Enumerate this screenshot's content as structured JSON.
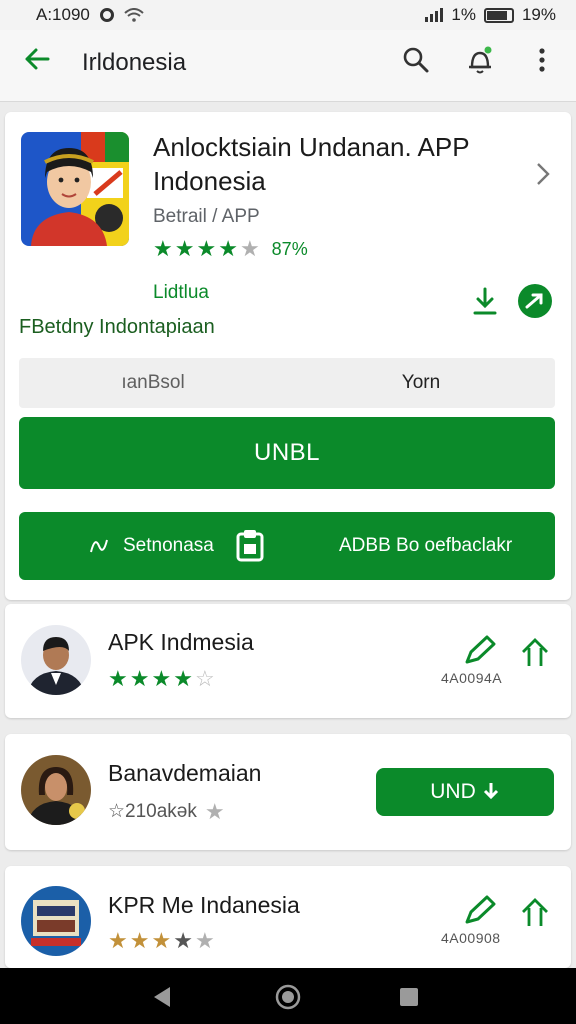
{
  "status_bar": {
    "time": "A:1090",
    "battery_a": "1%",
    "battery_b": "19%"
  },
  "app_bar": {
    "title": "Irldonesia",
    "icons": [
      "back-arrow-icon",
      "search-icon",
      "notification-icon",
      "more-vert-icon"
    ]
  },
  "hero": {
    "title": "Anlocktsiain Undanan. APP Indonesia",
    "developer": "Betrail / APP",
    "rating_filled": 4,
    "rating_pct": "87%",
    "tag": "Lidtlua",
    "subtitle": "FBetdny Indontapiaan",
    "segment_left": "ıanBsol",
    "segment_right": "Yorn",
    "primary_button": "UNBL",
    "secondary_left": "Setnonasa",
    "secondary_right": "ADBB Bo oefbaclakr"
  },
  "list": [
    {
      "title": "APK Indmesia",
      "rating_filled": 4,
      "meta": "4A0094A",
      "action": "icons"
    },
    {
      "title": "Banavdemaian",
      "rating_text": "☆210akək",
      "action": "button",
      "button_label": "UND"
    },
    {
      "title": "KPR Me Indanesia",
      "rating_filled": 3,
      "meta": "4A00908",
      "action": "icons"
    }
  ],
  "colors": {
    "accent": "#0b8a2a",
    "background": "#ececec",
    "card": "#ffffff"
  }
}
